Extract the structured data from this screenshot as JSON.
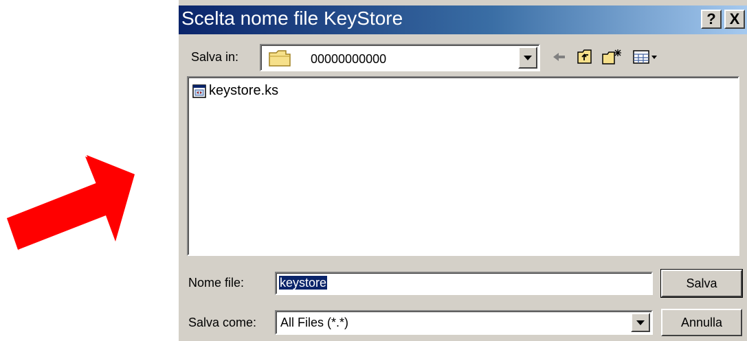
{
  "dialog": {
    "title": "Scelta nome file KeyStore",
    "help_button": "?",
    "close_button": "X"
  },
  "save_in": {
    "label": "Salva in:",
    "folder": "00000000000"
  },
  "toolbar": {
    "icons": [
      "back-arrow-icon",
      "up-folder-icon",
      "new-folder-icon",
      "view-menu-icon"
    ]
  },
  "files": [
    {
      "name": "keystore.ks",
      "icon": "keystore-file-icon"
    }
  ],
  "filename": {
    "label": "Nome file:",
    "value": "keystore"
  },
  "save_as": {
    "label": "Salva come:",
    "value": "All Files (*.*)"
  },
  "buttons": {
    "save": "Salva",
    "cancel": "Annulla"
  },
  "colors": {
    "annotation_arrow": "#ff0000",
    "title_bar": "#0a246a",
    "selection": "#0a246a"
  }
}
